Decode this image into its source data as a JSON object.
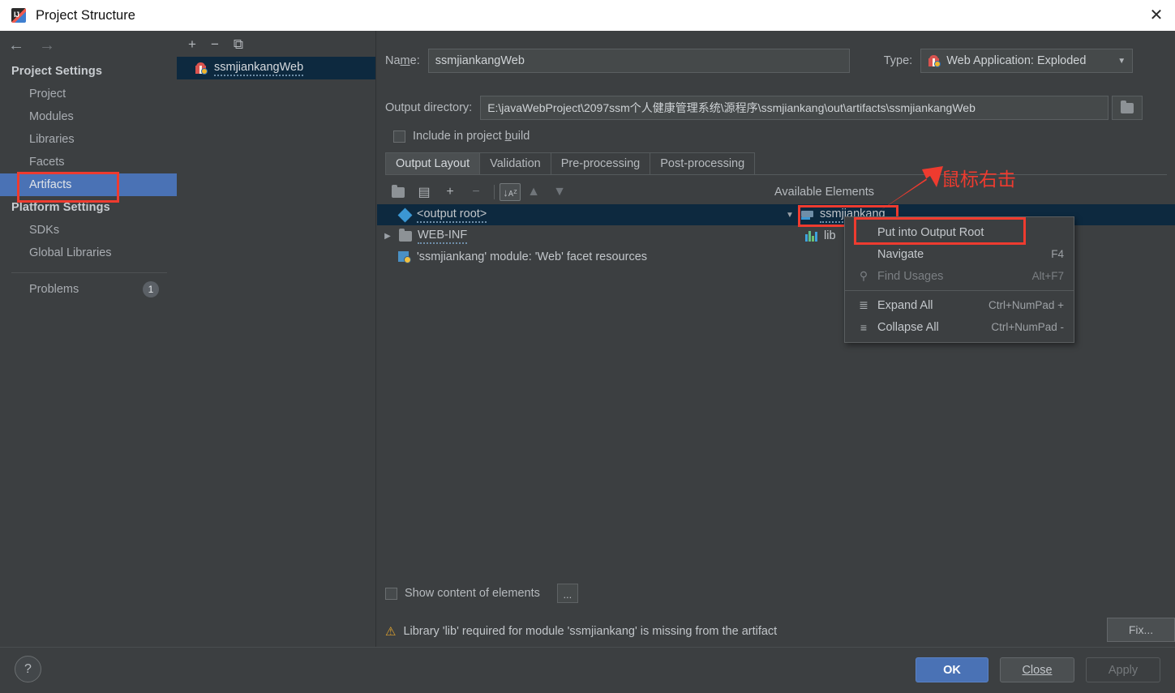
{
  "window": {
    "title": "Project Structure",
    "icon": "intellij-idea-icon",
    "close_label": "✕"
  },
  "sidebar": {
    "nav": {
      "back": "←",
      "forward": "→"
    },
    "sections": [
      {
        "heading": "Project Settings",
        "items": [
          {
            "label": "Project",
            "selected": false
          },
          {
            "label": "Modules",
            "selected": false
          },
          {
            "label": "Libraries",
            "selected": false
          },
          {
            "label": "Facets",
            "selected": false
          },
          {
            "label": "Artifacts",
            "selected": true,
            "annotated": true
          }
        ]
      },
      {
        "heading": "Platform Settings",
        "items": [
          {
            "label": "SDKs",
            "selected": false
          },
          {
            "label": "Global Libraries",
            "selected": false
          }
        ]
      }
    ],
    "problems": {
      "label": "Problems",
      "count": "1"
    }
  },
  "list_pane": {
    "toolbar": [
      {
        "name": "add-artifact-button",
        "glyph": "+"
      },
      {
        "name": "remove-artifact-button",
        "glyph": "−"
      },
      {
        "name": "copy-artifact-button",
        "glyph": "⧉"
      }
    ],
    "items": [
      {
        "label": "ssmjiankangWeb",
        "icon": "artifact-gift-icon",
        "selected": true
      }
    ]
  },
  "main": {
    "name_label": "Name:",
    "name_value": "ssmjiankangWeb",
    "type_label": "Type:",
    "type_value": "Web Application: Exploded",
    "output_dir_label": "Output directory:",
    "output_dir_value": "E:\\javaWebProject\\2097ssm个人健康管理系统\\源程序\\ssmjiankang\\out\\artifacts\\ssmjiankangWeb",
    "include_in_build_label": "Include in project build",
    "include_in_build_checked": false,
    "tabs": [
      {
        "label": "Output Layout",
        "active": true
      },
      {
        "label": "Validation",
        "active": false
      },
      {
        "label": "Pre-processing",
        "active": false
      },
      {
        "label": "Post-processing",
        "active": false
      }
    ],
    "layout_toolbar": [
      {
        "name": "create-directory-button",
        "glyph": "🗁"
      },
      {
        "name": "create-archive-button",
        "glyph": "▤"
      },
      {
        "name": "add-copy-button",
        "glyph": "+"
      },
      {
        "name": "remove-element-button",
        "glyph": "−",
        "disabled": true
      },
      {
        "name": "sort-button",
        "glyph": "↓ᴀᶻ",
        "boxed": true
      },
      {
        "name": "move-up-button",
        "glyph": "▲",
        "disabled": true
      },
      {
        "name": "move-down-button",
        "glyph": "▼",
        "disabled": true
      }
    ],
    "available_elements_title": "Available Elements",
    "output_tree": [
      {
        "label": "<output root>",
        "icon": "output-root-icon",
        "indent": 0,
        "selected": true,
        "twisty": ""
      },
      {
        "label": "WEB-INF",
        "icon": "folder-icon",
        "indent": 1,
        "selected": false,
        "twisty": "▶"
      },
      {
        "label": "'ssmjiankang' module: 'Web' facet resources",
        "icon": "facet-icon",
        "indent": 1,
        "selected": false,
        "twisty": ""
      }
    ],
    "available_tree": [
      {
        "label": "ssmjiankang",
        "icon": "module-icon",
        "indent": 0,
        "selected": true,
        "twisty": "▼",
        "annotated": true
      },
      {
        "label": "lib",
        "icon": "library-bars-icon",
        "indent": 1,
        "selected": false,
        "twisty": ""
      }
    ],
    "show_content_label": "Show content of elements",
    "show_content_checked": false,
    "dots_button_label": "...",
    "warning_text": "Library 'lib' required for module 'ssmjiankang' is missing from the artifact",
    "warning_icon": "warning-triangle-icon",
    "fix_button_label": "Fix..."
  },
  "context_menu": {
    "items": [
      {
        "label": "Put into Output Root",
        "shortcut": "",
        "icon": "",
        "disabled": false,
        "highlighted": true
      },
      {
        "label": "Navigate",
        "shortcut": "F4",
        "icon": "",
        "disabled": false
      },
      {
        "label": "Find Usages",
        "shortcut": "Alt+F7",
        "icon": "search-icon",
        "disabled": true
      },
      {
        "separator": true
      },
      {
        "label": "Expand All",
        "shortcut": "Ctrl+NumPad +",
        "icon": "expand-all-icon",
        "disabled": false
      },
      {
        "label": "Collapse All",
        "shortcut": "Ctrl+NumPad -",
        "icon": "collapse-all-icon",
        "disabled": false
      }
    ]
  },
  "annotation": {
    "text": "鼠标右击",
    "color": "#ee3b2f"
  },
  "footer": {
    "help_label": "?",
    "ok_label": "OK",
    "close_label": "Close",
    "apply_label": "Apply",
    "apply_disabled": true
  },
  "colors": {
    "background": "#3c3f41",
    "selection_blue": "#4a72b5",
    "tree_selection": "#0d293f",
    "annotation_red": "#ee3b2f",
    "warning_amber": "#e0a32e"
  }
}
